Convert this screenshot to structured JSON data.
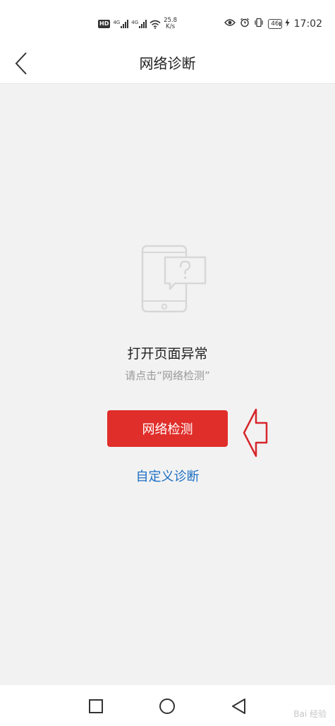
{
  "status_bar": {
    "hd": "HD",
    "signal_labels": [
      "4G",
      "4G"
    ],
    "speed_value": "25.8",
    "speed_unit": "K/s",
    "battery": "46",
    "time": "17:02"
  },
  "header": {
    "title": "网络诊断"
  },
  "error": {
    "title": "打开页面异常",
    "subtitle": "请点击“网络检测”"
  },
  "actions": {
    "detect_label": "网络检测",
    "custom_label": "自定义诊断"
  },
  "watermark": {
    "text": "Bai 经验"
  },
  "colors": {
    "accent_red": "#e02e2a",
    "link_blue": "#1a6fc4",
    "background": "#f2f2f2"
  }
}
